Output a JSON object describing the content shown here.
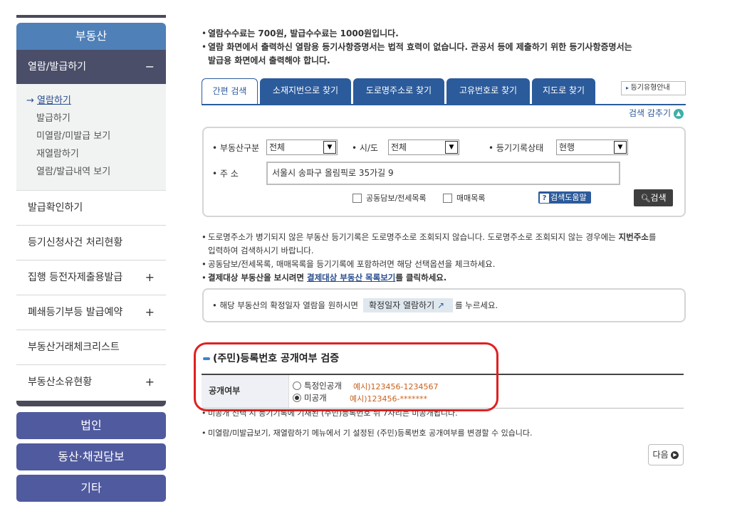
{
  "sidebar": {
    "header": "부동산",
    "open_section": {
      "label": "열람/발급하기",
      "toggle": "−"
    },
    "sub_items": [
      {
        "prefix": "→ ",
        "label": "열람하기"
      },
      {
        "label": "발급하기"
      },
      {
        "label": "미열람/미발급 보기"
      },
      {
        "label": "재열람하기"
      },
      {
        "label": "열람/발급내역 보기"
      }
    ],
    "rows": [
      {
        "label": "발급확인하기",
        "toggle": ""
      },
      {
        "label": "등기신청사건 처리현황",
        "toggle": ""
      },
      {
        "label": "집행 등전자제출용발급",
        "toggle": "+"
      },
      {
        "label": "폐쇄등기부등 발급예약",
        "toggle": "+"
      },
      {
        "label": "부동산거래체크리스트",
        "toggle": ""
      },
      {
        "label": "부동산소유현황",
        "toggle": "+"
      }
    ],
    "buttons": [
      "법인",
      "동산·채권담보",
      "기타"
    ]
  },
  "top_notes": {
    "line1": "열람수수료는 700원, 발급수수료는 1000원입니다.",
    "line2a": "열람 화면에서 출력하신 열람용 등기사항증명서는 법적 효력이 없습니다. 관공서 등에 제출하기 위한 등기사항증명서는",
    "line2b": "발급용 화면에서 출력해야 합니다."
  },
  "tabs": [
    "간편 검색",
    "소재지번으로 찾기",
    "도로명주소로 찾기",
    "고유번호로 찾기",
    "지도로 찾기"
  ],
  "reg_guide": "등기유형안내",
  "collapse_label": "검색 감추기",
  "search": {
    "property_type_label": "부동산구분",
    "property_type_value": "전체",
    "region_label": "시/도",
    "region_value": "전체",
    "status_label": "등기기록상태",
    "status_value": "현행",
    "address_label": "주 소",
    "address_value": "서울시 송파구 올림픽로 35가길 9",
    "check1": "공동담보/전세목록",
    "check2": "매매목록",
    "help_label": "검색도움말",
    "search_label": "검색"
  },
  "mid_notes": {
    "n1a": "도로명주소가 병기되지 않은 부동산 등기기록은 도로명주소로 조회되지 않습니다. 도로명주소로 조회되지 않는 경우에는 ",
    "n1b": "지번주소",
    "n1c": "를",
    "n1d": "입력하여 검색하시기 바랍니다.",
    "n2": "공동담보/전세목록, 매매목록을 등기기록에 포함하려면 해당 선택옵션을 체크하세요.",
    "n3a": "결제대상 부동산을 보시려면 ",
    "n3link": "결제대상 부동산 목록보기",
    "n3b": "를 클릭하세요."
  },
  "info": {
    "text_before": "해당 부동산의 확정일자 열람을 원하시면",
    "button": "확정일자 열람하기",
    "text_after": "를 누르세요."
  },
  "section": {
    "title": "(주민)등록번호 공개여부 검증",
    "row_header": "공개여부",
    "opt1_label": "특정인공개",
    "opt1_example": "예시)123456-1234567",
    "opt2_label": "미공개",
    "opt2_example": "예시)123456-*******"
  },
  "bottom_notes": {
    "b1": "미공개 선택 시 등기기록에 기재된 (주민)등록번호 뒤 7자리는 미공개됩니다.",
    "b2": "미열람/미발급보기, 재열람하기 메뉴에서 기 설정된 (주민)등록번호 공개여부를 변경할 수 있습니다."
  },
  "next_label": "다음",
  "colors": {
    "tab_blue": "#2c5b9b",
    "sidebar_head": "#4f80b8",
    "sidebar_btn": "#505a9e",
    "highlight_red": "#e02020"
  }
}
